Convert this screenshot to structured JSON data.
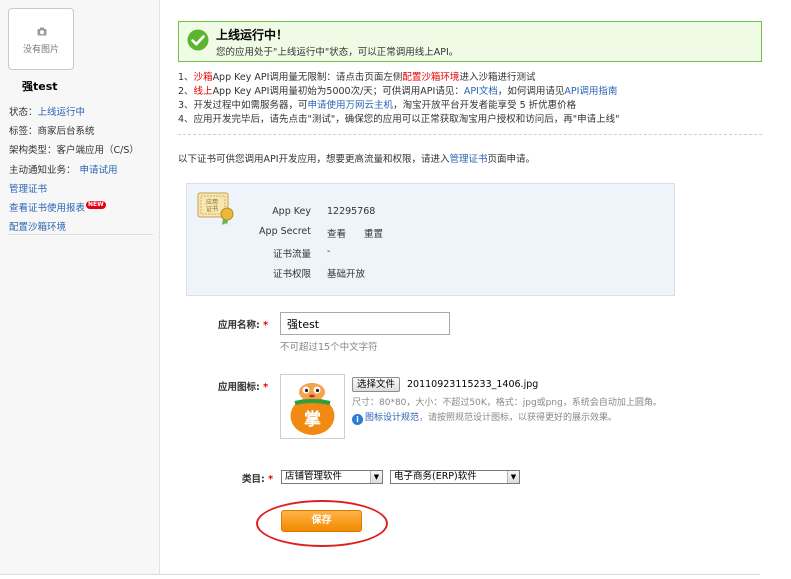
{
  "sidebar": {
    "no_image": "没有图片",
    "app_name": "强test",
    "status_label": "状态：",
    "status_value": "上线运行中",
    "tag_label": "标签：",
    "tag_value": "商家后台系统",
    "arch_label": "架构类型：",
    "arch_value": "客户端应用（C/S）",
    "notify_label": "主动通知业务：",
    "notify_link": "申请试用",
    "links": [
      "管理证书",
      "查看证书使用报表",
      "配置沙箱环境"
    ],
    "new_badge": "NEW"
  },
  "banner": {
    "title": "上线运行中！",
    "desc": "您的应用处于\"上线运行中\"状态，可以正常调用线上API。"
  },
  "notes": {
    "n1_a": "1、",
    "n1_sandbox": "沙箱",
    "n1_b": "App Key API调用量无限制：请点击页面左侧",
    "n1_link": "配置沙箱环境",
    "n1_c": "进入沙箱进行测试",
    "n2_a": "2、",
    "n2_online": "线上",
    "n2_b": "App Key API调用量初始为5000次/天；可供调用API请见：",
    "n2_link1": "API文档",
    "n2_c": "，如何调用请见",
    "n2_link2": "API调用指南",
    "n3_a": "3、开发过程中如需服务器，可",
    "n3_link": "申请使用万网云主机",
    "n3_b": "，淘宝开放平台开发者能享受 5 折优惠价格",
    "n4": "4、应用开发完毕后，请先点击\"测试\"，确保您的应用可以正常获取淘宝用户授权和访问后，再\"申请上线\""
  },
  "cert_intro": {
    "a": "以下证书可供您调用API开发应用，想要更高流量和权限，请进入",
    "link": "管理证书",
    "b": "页面申请。"
  },
  "cert": {
    "icon_text": "应用证书",
    "appkey_label": "App Key",
    "appkey_value": "12295768",
    "secret_label": "App Secret",
    "secret_view": "查看",
    "secret_reset": "重置",
    "flow_label": "证书流量",
    "flow_value": "-",
    "perm_label": "证书权限",
    "perm_value": "基础开放"
  },
  "form": {
    "name_label": "应用名称:",
    "name_value": "强test",
    "name_hint": "不可超过15个中文字符",
    "icon_label": "应用图标:",
    "icon_char": "掌",
    "choose_file": "选择文件",
    "file_name": "20110923115233_1406.jpg",
    "size_hint": "尺寸：80*80，大小：不超过50K，格式：jpg或png，系统会自动加上圆角。",
    "spec_link": "图标设计规范",
    "spec_text": "，请按照规范设计图标，以获得更好的展示效果。",
    "category_label": "类目:",
    "category1": "店铺管理软件",
    "category2": "电子商务(ERP)软件",
    "required_mark": "*",
    "save": "保存"
  },
  "colors": {
    "accent_orange": "#f28a00",
    "banner_green": "#71c243",
    "link_blue": "#2a64b4",
    "highlight_red": "#e02020"
  }
}
